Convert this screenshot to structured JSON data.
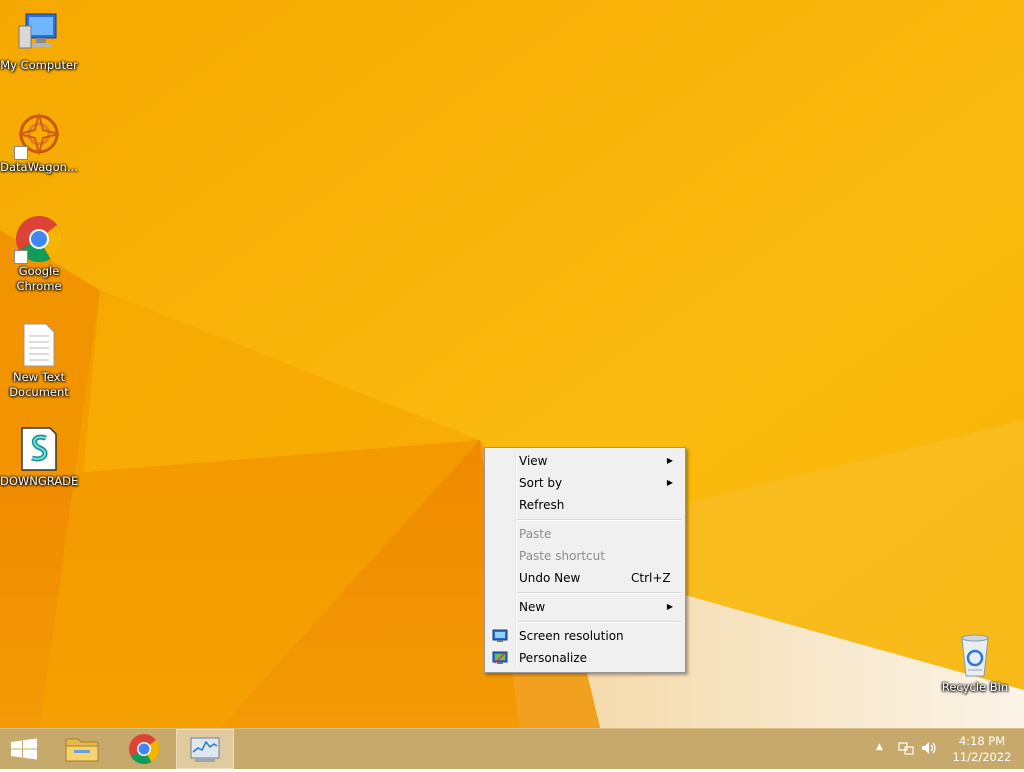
{
  "desktop": {
    "icons": [
      {
        "label": "My Computer"
      },
      {
        "label": "DataWagon..."
      },
      {
        "label": "Google Chrome"
      },
      {
        "label": "New Text Document"
      },
      {
        "label": "DOWNGRADE"
      },
      {
        "label": "Recycle Bin"
      }
    ]
  },
  "context_menu": {
    "items": [
      {
        "label": "View",
        "submenu": true,
        "enabled": true
      },
      {
        "label": "Sort by",
        "submenu": true,
        "enabled": true
      },
      {
        "label": "Refresh",
        "enabled": true
      },
      {
        "label": "Paste",
        "enabled": false
      },
      {
        "label": "Paste shortcut",
        "enabled": false
      },
      {
        "label": "Undo New",
        "shortcut": "Ctrl+Z",
        "enabled": true
      },
      {
        "label": "New",
        "submenu": true,
        "enabled": true
      },
      {
        "label": "Screen resolution",
        "icon": "display-icon",
        "enabled": true
      },
      {
        "label": "Personalize",
        "icon": "personalize-icon",
        "enabled": true
      }
    ]
  },
  "taskbar": {
    "buttons": [
      "start-button",
      "file-explorer-icon",
      "chrome-icon",
      "task-manager-icon"
    ],
    "clock": {
      "time": "4:18 PM",
      "date": "11/2/2022"
    }
  },
  "colors": {
    "wallpaper": "#f7b000",
    "taskbar": "#c8a96c"
  }
}
